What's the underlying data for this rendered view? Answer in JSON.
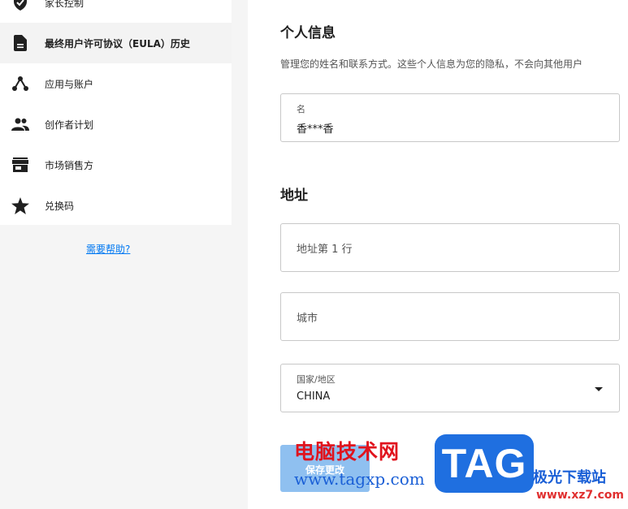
{
  "sidebar": {
    "items": [
      {
        "label": "家长控制",
        "icon": "shield-check-icon"
      },
      {
        "label": "最终用户许可协议（EULA）历史",
        "icon": "document-icon"
      },
      {
        "label": "应用与账户",
        "icon": "nodes-icon"
      },
      {
        "label": "创作者计划",
        "icon": "people-icon"
      },
      {
        "label": "市场销售方",
        "icon": "store-icon"
      },
      {
        "label": "兑换码",
        "icon": "star-icon"
      }
    ],
    "help_link": "需要帮助?"
  },
  "personal_info": {
    "title": "个人信息",
    "description": "管理您的姓名和联系方式。这些个人信息为您的隐私，不会向其他用户",
    "name_label": "名",
    "name_value": "香***香"
  },
  "address": {
    "title": "地址",
    "line1_placeholder": "地址第 1 行",
    "city_placeholder": "城市",
    "country_label": "国家/地区",
    "country_value": "CHINA"
  },
  "save_button": "保存更改",
  "watermark": {
    "brand_cn": "电脑技术网",
    "url": "www.tagxp.com",
    "logo": "TAG",
    "site_cn": "极光下载站",
    "site_url": "www.xz7.com"
  },
  "colors": {
    "link": "#0078f2",
    "button_disabled": "#8fc0f0",
    "watermark_red": "#e0141e",
    "watermark_blue": "#1f6fe0"
  }
}
